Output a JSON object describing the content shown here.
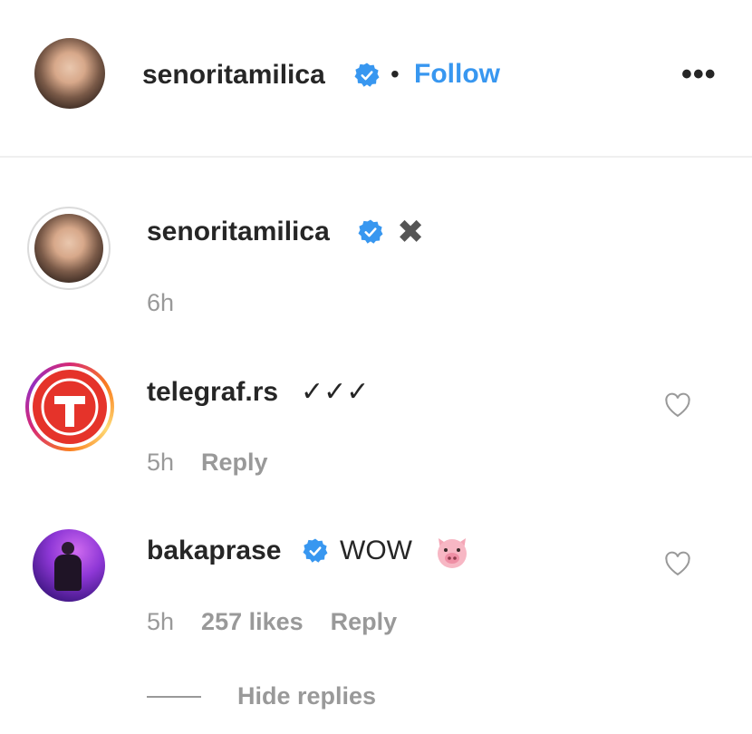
{
  "header": {
    "username": "senoritamilica",
    "separator": "•",
    "follow_label": "Follow",
    "more_label": "•••"
  },
  "caption": {
    "username": "senoritamilica",
    "emoji": "✖",
    "time": "6h"
  },
  "comments": [
    {
      "username": "telegraf.rs",
      "text": "✓✓✓",
      "time": "5h",
      "reply_label": "Reply",
      "avatar_letter": "T"
    },
    {
      "username": "bakaprase",
      "text": "WOW",
      "emoji": "🐷",
      "time": "5h",
      "likes": "257 likes",
      "reply_label": "Reply"
    }
  ],
  "hide_replies_label": "Hide replies",
  "colors": {
    "accent": "#3897f0",
    "muted": "#999999",
    "text": "#262626"
  }
}
